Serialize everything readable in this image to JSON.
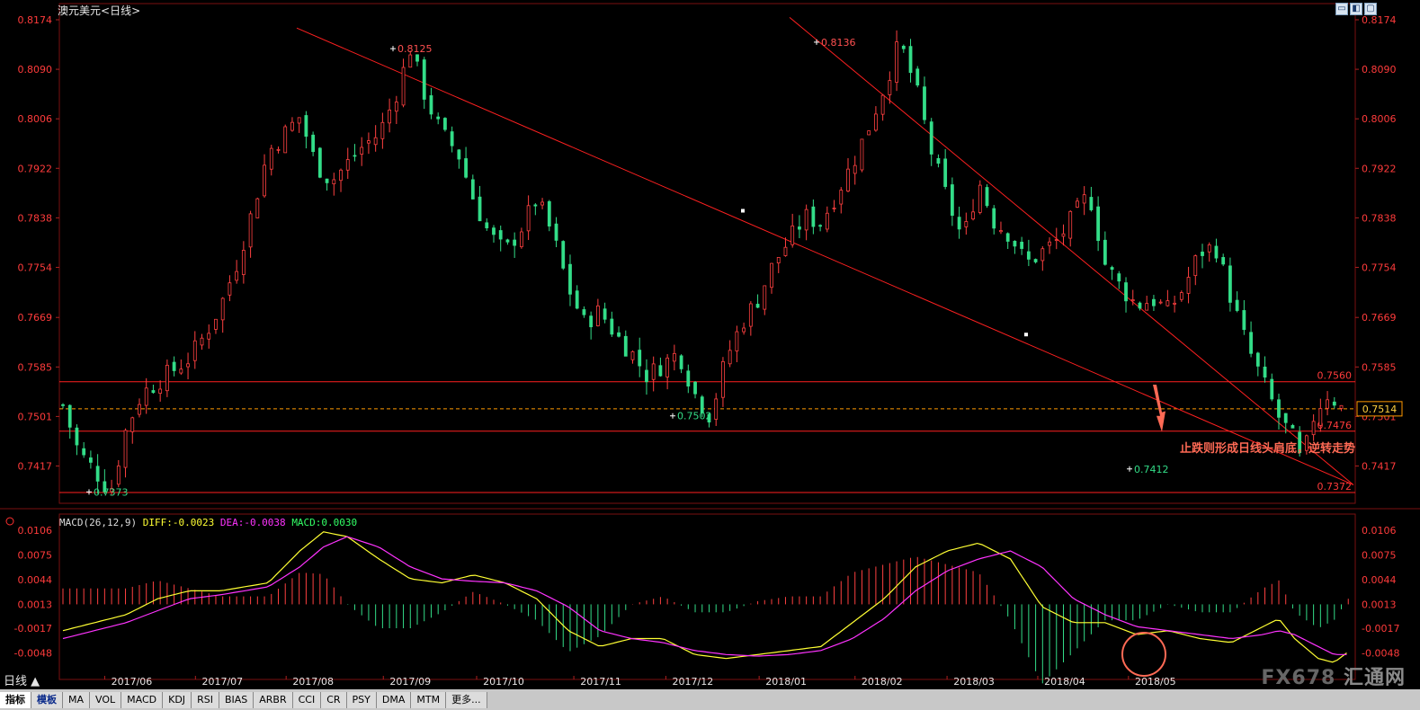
{
  "header": {
    "title": "澳元美元",
    "period_tag": "<日线>",
    "window_buttons": [
      "restore-icon",
      "window-icon",
      "maximize-icon"
    ]
  },
  "annotation": "止跌则形成日线头肩底，逆转走势",
  "price_marks": {
    "high1": "0.8125",
    "high2": "0.8136",
    "low1": "0.7373",
    "low2": "0.7502",
    "low3": "0.7412",
    "level_upper": "0.7560",
    "level_mid": "0.7476",
    "level_low": "0.7372",
    "current": "0.7514"
  },
  "macd": {
    "name": "MACD(26,12,9)",
    "diff": "DIFF:-0.0023",
    "dea": "DEA:-0.0038",
    "macd": "MACD:0.0030"
  },
  "bottom": {
    "period_label": "日线 ▲",
    "tabs": [
      "指标",
      "模板",
      "MA",
      "VOL",
      "MACD",
      "KDJ",
      "RSI",
      "BIAS",
      "ARBR",
      "CCI",
      "CR",
      "PSY",
      "DMA",
      "MTM",
      "更多..."
    ]
  },
  "logo": {
    "brand": "FX678",
    "cn": "汇通网"
  },
  "colors": {
    "up": "#ff4040",
    "down": "#33dd88",
    "line": "#ff2020",
    "dash": "#ff9900",
    "diff": "#ffff33",
    "dea": "#ff33ff"
  },
  "chart_data": [
    {
      "type": "candlestick",
      "title": "澳元美元",
      "x_ticks": [
        "2017/06",
        "2017/07",
        "2017/08",
        "2017/09",
        "2017/10",
        "2017/11",
        "2017/12",
        "2018/01",
        "2018/02",
        "2018/03",
        "2018/04",
        "2018/05"
      ],
      "y_ticks": [
        "0.8174",
        "0.8090",
        "0.8006",
        "0.7922",
        "0.7838",
        "0.7754",
        "0.7669",
        "0.7585",
        "0.7501",
        "0.7417"
      ],
      "ylim": [
        0.7372,
        0.8174
      ],
      "price_path": [
        [
          0,
          0.752
        ],
        [
          10,
          0.744
        ],
        [
          20,
          0.741
        ],
        [
          30,
          0.7373
        ],
        [
          40,
          0.748
        ],
        [
          50,
          0.754
        ],
        [
          60,
          0.756
        ],
        [
          70,
          0.758
        ],
        [
          80,
          0.76
        ],
        [
          90,
          0.764
        ],
        [
          100,
          0.769
        ],
        [
          110,
          0.776
        ],
        [
          120,
          0.785
        ],
        [
          130,
          0.795
        ],
        [
          140,
          0.798
        ],
        [
          150,
          0.801
        ],
        [
          160,
          0.793
        ],
        [
          170,
          0.79
        ],
        [
          180,
          0.793
        ],
        [
          190,
          0.796
        ],
        [
          200,
          0.798
        ],
        [
          210,
          0.804
        ],
        [
          220,
          0.8125
        ],
        [
          230,
          0.804
        ],
        [
          240,
          0.798
        ],
        [
          250,
          0.795
        ],
        [
          260,
          0.787
        ],
        [
          270,
          0.781
        ],
        [
          280,
          0.778
        ],
        [
          290,
          0.782
        ],
        [
          300,
          0.787
        ],
        [
          310,
          0.781
        ],
        [
          320,
          0.772
        ],
        [
          330,
          0.766
        ],
        [
          340,
          0.768
        ],
        [
          350,
          0.764
        ],
        [
          360,
          0.761
        ],
        [
          370,
          0.757
        ],
        [
          380,
          0.759
        ],
        [
          390,
          0.761
        ],
        [
          400,
          0.754
        ],
        [
          410,
          0.7502
        ],
        [
          420,
          0.76
        ],
        [
          430,
          0.766
        ],
        [
          440,
          0.77
        ],
        [
          450,
          0.776
        ],
        [
          460,
          0.78
        ],
        [
          470,
          0.784
        ],
        [
          480,
          0.783
        ],
        [
          490,
          0.788
        ],
        [
          500,
          0.793
        ],
        [
          510,
          0.799
        ],
        [
          520,
          0.806
        ],
        [
          530,
          0.8136
        ],
        [
          540,
          0.806
        ],
        [
          550,
          0.795
        ],
        [
          560,
          0.787
        ],
        [
          570,
          0.78
        ],
        [
          580,
          0.79
        ],
        [
          590,
          0.783
        ],
        [
          600,
          0.781
        ],
        [
          610,
          0.776
        ],
        [
          620,
          0.778
        ],
        [
          630,
          0.78
        ],
        [
          640,
          0.784
        ],
        [
          650,
          0.788
        ],
        [
          660,
          0.776
        ],
        [
          670,
          0.772
        ],
        [
          680,
          0.769
        ],
        [
          690,
          0.77
        ],
        [
          700,
          0.768
        ],
        [
          710,
          0.772
        ],
        [
          720,
          0.778
        ],
        [
          730,
          0.779
        ],
        [
          740,
          0.77
        ],
        [
          750,
          0.762
        ],
        [
          760,
          0.756
        ],
        [
          770,
          0.75
        ],
        [
          780,
          0.746
        ],
        [
          785,
          0.7412
        ],
        [
          790,
          0.749
        ],
        [
          800,
          0.754
        ],
        [
          805,
          0.753
        ],
        [
          810,
          0.7514
        ]
      ],
      "trendlines": [
        {
          "from": [
            "2017/08",
            0.8174
          ],
          "to": [
            "2018/05",
            0.739
          ],
          "label": ""
        },
        {
          "from": [
            "2018/01",
            0.817
          ],
          "to": [
            "2018/05",
            0.739
          ],
          "label": ""
        }
      ],
      "horizontal_levels": [
        0.756,
        0.7476,
        0.7372
      ],
      "current_price_line": 0.7514,
      "point_labels": [
        {
          "x": "2017/09",
          "y": 0.8125,
          "text": "0.8125"
        },
        {
          "x": "2018/01",
          "y": 0.8136,
          "text": "0.8136"
        },
        {
          "x": "2017/06",
          "y": 0.7373,
          "text": "0.7373"
        },
        {
          "x": "2017/12",
          "y": 0.7502,
          "text": "0.7502"
        },
        {
          "x": "2018/05",
          "y": 0.7412,
          "text": "0.7412"
        }
      ]
    },
    {
      "type": "macd",
      "title": "MACD(26,12,9)",
      "y_ticks": [
        "0.0106",
        "0.0075",
        "0.0044",
        "0.0013",
        "-0.0017",
        "-0.0048"
      ],
      "ylim": [
        -0.007,
        0.0106
      ],
      "series": [
        {
          "name": "DIFF",
          "values_key": "diff_path"
        },
        {
          "name": "DEA",
          "values_key": "dea_path"
        },
        {
          "name": "MACD",
          "values_key": "hist"
        }
      ],
      "diff_path": [
        [
          0,
          -0.002
        ],
        [
          20,
          -0.001
        ],
        [
          40,
          0.0
        ],
        [
          60,
          0.002
        ],
        [
          80,
          0.003
        ],
        [
          100,
          0.003
        ],
        [
          115,
          0.0035
        ],
        [
          130,
          0.004
        ],
        [
          150,
          0.008
        ],
        [
          165,
          0.0104
        ],
        [
          180,
          0.0098
        ],
        [
          200,
          0.007
        ],
        [
          220,
          0.0045
        ],
        [
          240,
          0.004
        ],
        [
          260,
          0.005
        ],
        [
          280,
          0.004
        ],
        [
          300,
          0.002
        ],
        [
          320,
          -0.002
        ],
        [
          340,
          -0.004
        ],
        [
          360,
          -0.003
        ],
        [
          380,
          -0.003
        ],
        [
          400,
          -0.005
        ],
        [
          420,
          -0.0055
        ],
        [
          440,
          -0.005
        ],
        [
          460,
          -0.0045
        ],
        [
          480,
          -0.004
        ],
        [
          500,
          -0.001
        ],
        [
          520,
          0.002
        ],
        [
          540,
          0.006
        ],
        [
          560,
          0.008
        ],
        [
          580,
          0.009
        ],
        [
          600,
          0.007
        ],
        [
          620,
          0.001
        ],
        [
          640,
          -0.001
        ],
        [
          660,
          -0.001
        ],
        [
          680,
          -0.0025
        ],
        [
          700,
          -0.002
        ],
        [
          720,
          -0.003
        ],
        [
          740,
          -0.0035
        ],
        [
          760,
          -0.0015
        ],
        [
          770,
          -0.0005
        ],
        [
          780,
          -0.003
        ],
        [
          795,
          -0.0055
        ],
        [
          805,
          -0.006
        ],
        [
          815,
          -0.0045
        ]
      ],
      "dea_path": [
        [
          0,
          -0.003
        ],
        [
          20,
          -0.002
        ],
        [
          40,
          -0.001
        ],
        [
          60,
          0.0005
        ],
        [
          80,
          0.002
        ],
        [
          100,
          0.0025
        ],
        [
          115,
          0.003
        ],
        [
          130,
          0.0035
        ],
        [
          150,
          0.006
        ],
        [
          165,
          0.0085
        ],
        [
          180,
          0.0098
        ],
        [
          200,
          0.0085
        ],
        [
          220,
          0.006
        ],
        [
          240,
          0.0045
        ],
        [
          260,
          0.0042
        ],
        [
          280,
          0.004
        ],
        [
          300,
          0.003
        ],
        [
          320,
          0.001
        ],
        [
          340,
          -0.002
        ],
        [
          360,
          -0.003
        ],
        [
          380,
          -0.0035
        ],
        [
          400,
          -0.0045
        ],
        [
          420,
          -0.005
        ],
        [
          440,
          -0.0052
        ],
        [
          460,
          -0.005
        ],
        [
          480,
          -0.0045
        ],
        [
          500,
          -0.003
        ],
        [
          520,
          -0.0005
        ],
        [
          540,
          0.003
        ],
        [
          560,
          0.0055
        ],
        [
          580,
          0.007
        ],
        [
          600,
          0.008
        ],
        [
          620,
          0.006
        ],
        [
          640,
          0.002
        ],
        [
          660,
          0.0
        ],
        [
          680,
          -0.0015
        ],
        [
          700,
          -0.002
        ],
        [
          720,
          -0.0025
        ],
        [
          740,
          -0.003
        ],
        [
          760,
          -0.0025
        ],
        [
          770,
          -0.002
        ],
        [
          780,
          -0.0025
        ],
        [
          795,
          -0.004
        ],
        [
          805,
          -0.005
        ],
        [
          815,
          -0.005
        ]
      ]
    }
  ]
}
